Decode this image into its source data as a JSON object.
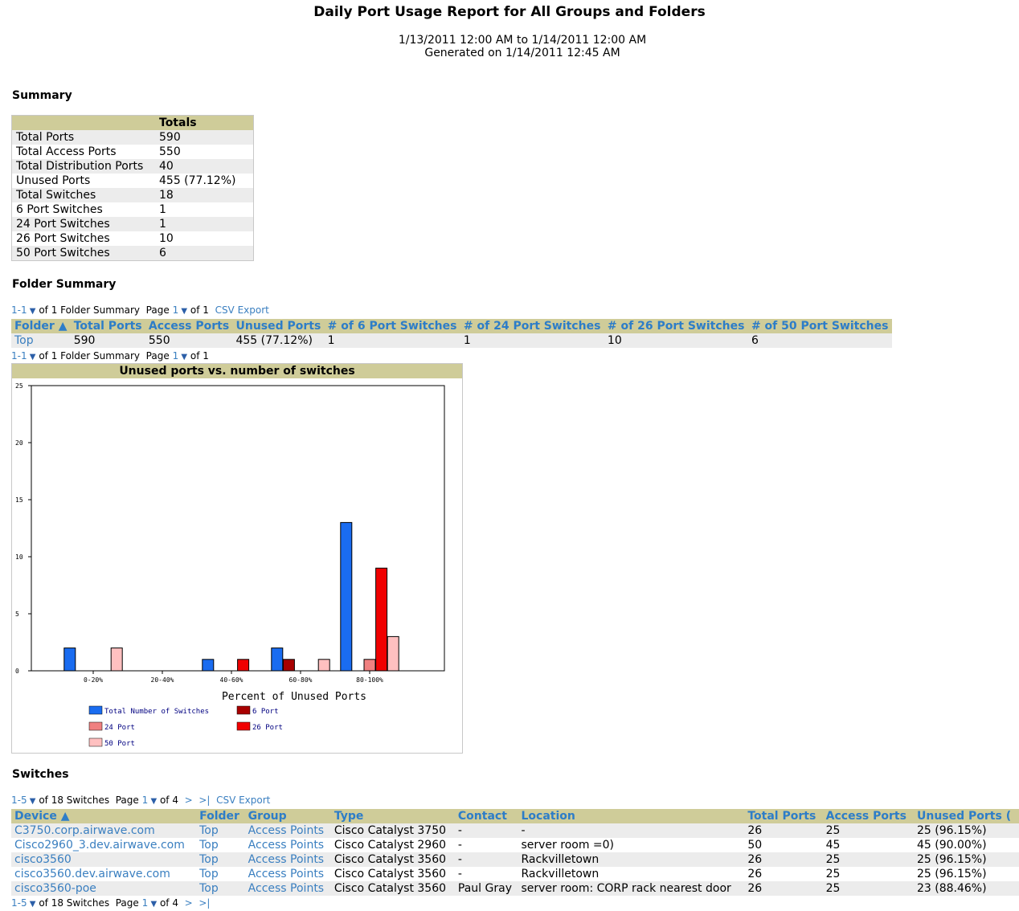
{
  "header": {
    "title": "Daily Port Usage Report for All Groups and Folders",
    "range": "1/13/2011 12:00 AM to 1/14/2011 12:00 AM",
    "generated": "Generated on 1/14/2011 12:45 AM"
  },
  "summary": {
    "heading": "Summary",
    "col_header": "Totals",
    "rows": [
      {
        "label": "Total Ports",
        "value": "590"
      },
      {
        "label": "Total Access Ports",
        "value": "550"
      },
      {
        "label": "Total Distribution Ports",
        "value": "40"
      },
      {
        "label": "Unused Ports",
        "value": "455 (77.12%)"
      },
      {
        "label": "Total Switches",
        "value": "18"
      },
      {
        "label": "6 Port Switches",
        "value": "1"
      },
      {
        "label": "24 Port Switches",
        "value": "1"
      },
      {
        "label": "26 Port Switches",
        "value": "10"
      },
      {
        "label": "50 Port Switches",
        "value": "6"
      }
    ]
  },
  "folder_summary": {
    "heading": "Folder Summary",
    "pager": {
      "range": "1-1",
      "of_text": "of 1 Folder Summary",
      "page_label": "Page",
      "page": "1",
      "page_of": "of 1",
      "csv": "CSV Export"
    },
    "columns": [
      "Folder ▲",
      "Total Ports",
      "Access Ports",
      "Unused Ports",
      "# of 6 Port Switches",
      "# of 24 Port Switches",
      "# of 26 Port Switches",
      "# of 50 Port Switches"
    ],
    "rows": [
      [
        "Top",
        "590",
        "550",
        "455 (77.12%)",
        "1",
        "1",
        "10",
        "6"
      ]
    ]
  },
  "chart_data": {
    "type": "bar",
    "title": "Unused ports vs. number of switches",
    "xlabel": "Percent of Unused Ports",
    "ylabel": "",
    "ylim": [
      0,
      25
    ],
    "yticks": [
      0,
      5,
      10,
      15,
      20,
      25
    ],
    "categories": [
      "0-20%",
      "20-40%",
      "40-60%",
      "60-80%",
      "80-100%"
    ],
    "series": [
      {
        "name": "Total Number of Switches",
        "color": "#1a6cf0",
        "values": [
          2,
          0,
          1,
          2,
          13
        ]
      },
      {
        "name": "6 Port",
        "color": "#a80000",
        "values": [
          0,
          0,
          0,
          1,
          0
        ]
      },
      {
        "name": "24 Port",
        "color": "#f08080",
        "values": [
          0,
          0,
          0,
          0,
          1
        ]
      },
      {
        "name": "26 Port",
        "color": "#f00000",
        "values": [
          0,
          0,
          1,
          0,
          9
        ]
      },
      {
        "name": "50 Port",
        "color": "#ffc0c0",
        "values": [
          2,
          0,
          0,
          1,
          3
        ]
      }
    ],
    "legend_color": "#000080"
  },
  "switches": {
    "heading": "Switches",
    "pager": {
      "range": "1-5",
      "of_text": "of 18 Switches",
      "page_label": "Page",
      "page": "1",
      "page_of": "of 4",
      "next": ">",
      "last": ">|",
      "csv": "CSV Export"
    },
    "columns": [
      "Device ▲",
      "Folder",
      "Group",
      "Type",
      "Contact",
      "Location",
      "Total Ports",
      "Access Ports",
      "Unused Ports ("
    ],
    "rows": [
      [
        "C3750.corp.airwave.com",
        "Top",
        "Access Points",
        "Cisco Catalyst 3750",
        "-",
        "-",
        "26",
        "25",
        "25 (96.15%)"
      ],
      [
        "Cisco2960_3.dev.airwave.com",
        "Top",
        "Access Points",
        "Cisco Catalyst 2960",
        "-",
        "server room =0)",
        "50",
        "45",
        "45 (90.00%)"
      ],
      [
        "cisco3560",
        "Top",
        "Access Points",
        "Cisco Catalyst 3560",
        "-",
        "Rackvilletown",
        "26",
        "25",
        "25 (96.15%)"
      ],
      [
        "cisco3560.dev.airwave.com",
        "Top",
        "Access Points",
        "Cisco Catalyst 3560",
        "-",
        "Rackvilletown",
        "26",
        "25",
        "25 (96.15%)"
      ],
      [
        "cisco3560-poe",
        "Top",
        "Access Points",
        "Cisco Catalyst 3560",
        "Paul Gray",
        "server room: CORP rack nearest door",
        "26",
        "25",
        "23 (88.46%)"
      ]
    ]
  }
}
